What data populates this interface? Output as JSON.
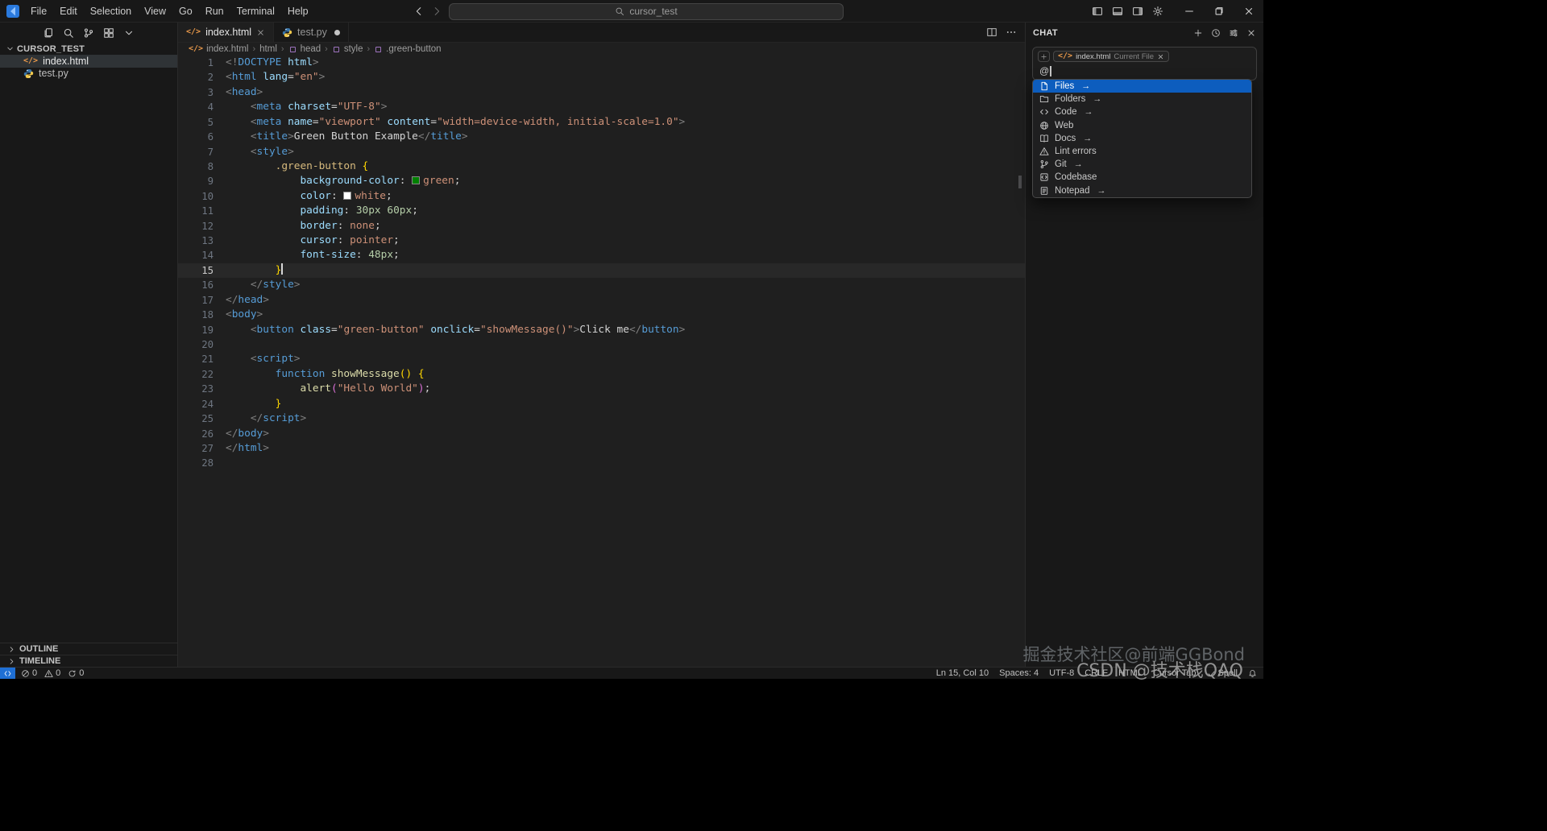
{
  "titlebar": {
    "menu": [
      "File",
      "Edit",
      "Selection",
      "View",
      "Go",
      "Run",
      "Terminal",
      "Help"
    ],
    "search_text": "cursor_test"
  },
  "activity_icons": [
    "explorer",
    "search",
    "source-control",
    "extensions",
    "chevron-down"
  ],
  "explorer": {
    "root": "CURSOR_TEST",
    "files": [
      {
        "name": "index.html",
        "icon": "html",
        "selected": true
      },
      {
        "name": "test.py",
        "icon": "python",
        "selected": false
      }
    ],
    "bottom_sections": [
      "OUTLINE",
      "TIMELINE"
    ]
  },
  "tabs": [
    {
      "label": "index.html",
      "icon": "html",
      "active": true,
      "state": "close"
    },
    {
      "label": "test.py",
      "icon": "python",
      "active": false,
      "state": "modified"
    }
  ],
  "breadcrumb": [
    {
      "label": "index.html",
      "icon": "html"
    },
    {
      "label": "html",
      "icon": null
    },
    {
      "label": "head",
      "icon": "symbol"
    },
    {
      "label": "style",
      "icon": "symbol"
    },
    {
      "label": ".green-button",
      "icon": "symbol"
    }
  ],
  "editor": {
    "active_line": 15,
    "lines": [
      [
        [
          "<!",
          "p"
        ],
        [
          "DOCTYPE",
          "tag"
        ],
        [
          " ",
          "txt"
        ],
        [
          "html",
          "attr"
        ],
        [
          ">",
          "p"
        ]
      ],
      [
        [
          "<",
          "p"
        ],
        [
          "html",
          "tag"
        ],
        [
          " ",
          "txt"
        ],
        [
          "lang",
          "attr"
        ],
        [
          "=",
          "txt"
        ],
        [
          "\"en\"",
          "str"
        ],
        [
          ">",
          "p"
        ]
      ],
      [
        [
          "<",
          "p"
        ],
        [
          "head",
          "tag"
        ],
        [
          ">",
          "p"
        ]
      ],
      [
        [
          "    ",
          "txt"
        ],
        [
          "<",
          "p"
        ],
        [
          "meta",
          "tag"
        ],
        [
          " ",
          "txt"
        ],
        [
          "charset",
          "attr"
        ],
        [
          "=",
          "txt"
        ],
        [
          "\"UTF-8\"",
          "str"
        ],
        [
          ">",
          "p"
        ]
      ],
      [
        [
          "    ",
          "txt"
        ],
        [
          "<",
          "p"
        ],
        [
          "meta",
          "tag"
        ],
        [
          " ",
          "txt"
        ],
        [
          "name",
          "attr"
        ],
        [
          "=",
          "txt"
        ],
        [
          "\"viewport\"",
          "str"
        ],
        [
          " ",
          "txt"
        ],
        [
          "content",
          "attr"
        ],
        [
          "=",
          "txt"
        ],
        [
          "\"width=device-width, initial-scale=1.0\"",
          "str"
        ],
        [
          ">",
          "p"
        ]
      ],
      [
        [
          "    ",
          "txt"
        ],
        [
          "<",
          "p"
        ],
        [
          "title",
          "tag"
        ],
        [
          ">",
          "p"
        ],
        [
          "Green Button Example",
          "txt"
        ],
        [
          "</",
          "p"
        ],
        [
          "title",
          "tag"
        ],
        [
          ">",
          "p"
        ]
      ],
      [
        [
          "    ",
          "txt"
        ],
        [
          "<",
          "p"
        ],
        [
          "style",
          "tag"
        ],
        [
          ">",
          "p"
        ]
      ],
      [
        [
          "        ",
          "txt"
        ],
        [
          ".green-button",
          "sel"
        ],
        [
          " ",
          "txt"
        ],
        [
          "{",
          "b1"
        ]
      ],
      [
        [
          "            ",
          "txt"
        ],
        [
          "background-color",
          "prop"
        ],
        [
          ": ",
          "txt"
        ],
        [
          "green",
          "val",
          "#008000"
        ],
        [
          ";",
          "txt"
        ]
      ],
      [
        [
          "            ",
          "txt"
        ],
        [
          "color",
          "prop"
        ],
        [
          ": ",
          "txt"
        ],
        [
          "white",
          "val",
          "#ffffff"
        ],
        [
          ";",
          "txt"
        ]
      ],
      [
        [
          "            ",
          "txt"
        ],
        [
          "padding",
          "prop"
        ],
        [
          ": ",
          "txt"
        ],
        [
          "30px",
          "num"
        ],
        [
          " ",
          "txt"
        ],
        [
          "60px",
          "num"
        ],
        [
          ";",
          "txt"
        ]
      ],
      [
        [
          "            ",
          "txt"
        ],
        [
          "border",
          "prop"
        ],
        [
          ": ",
          "txt"
        ],
        [
          "none",
          "val"
        ],
        [
          ";",
          "txt"
        ]
      ],
      [
        [
          "            ",
          "txt"
        ],
        [
          "cursor",
          "prop"
        ],
        [
          ": ",
          "txt"
        ],
        [
          "pointer",
          "val"
        ],
        [
          ";",
          "txt"
        ]
      ],
      [
        [
          "            ",
          "txt"
        ],
        [
          "font-size",
          "prop"
        ],
        [
          ": ",
          "txt"
        ],
        [
          "48px",
          "num"
        ],
        [
          ";",
          "txt"
        ]
      ],
      [
        [
          "        ",
          "txt"
        ],
        [
          "}",
          "b1"
        ]
      ],
      [
        [
          "    ",
          "txt"
        ],
        [
          "</",
          "p"
        ],
        [
          "style",
          "tag"
        ],
        [
          ">",
          "p"
        ]
      ],
      [
        [
          "</",
          "p"
        ],
        [
          "head",
          "tag"
        ],
        [
          ">",
          "p"
        ]
      ],
      [
        [
          "<",
          "p"
        ],
        [
          "body",
          "tag"
        ],
        [
          ">",
          "p"
        ]
      ],
      [
        [
          "    ",
          "txt"
        ],
        [
          "<",
          "p"
        ],
        [
          "button",
          "tag"
        ],
        [
          " ",
          "txt"
        ],
        [
          "class",
          "attr"
        ],
        [
          "=",
          "txt"
        ],
        [
          "\"green-button\"",
          "str"
        ],
        [
          " ",
          "txt"
        ],
        [
          "onclick",
          "attr"
        ],
        [
          "=",
          "txt"
        ],
        [
          "\"showMessage()\"",
          "str"
        ],
        [
          ">",
          "p"
        ],
        [
          "Click me",
          "txt"
        ],
        [
          "</",
          "p"
        ],
        [
          "button",
          "tag"
        ],
        [
          ">",
          "p"
        ]
      ],
      [],
      [
        [
          "    ",
          "txt"
        ],
        [
          "<",
          "p"
        ],
        [
          "script",
          "tag"
        ],
        [
          ">",
          "p"
        ]
      ],
      [
        [
          "        ",
          "txt"
        ],
        [
          "function",
          "kw"
        ],
        [
          " ",
          "txt"
        ],
        [
          "showMessage",
          "fn"
        ],
        [
          "(",
          "b1"
        ],
        [
          ")",
          "b1"
        ],
        [
          " ",
          "txt"
        ],
        [
          "{",
          "b1"
        ]
      ],
      [
        [
          "            ",
          "txt"
        ],
        [
          "alert",
          "fn"
        ],
        [
          "(",
          "b2"
        ],
        [
          "\"Hello World\"",
          "str"
        ],
        [
          ")",
          "b2"
        ],
        [
          ";",
          "txt"
        ]
      ],
      [
        [
          "        ",
          "txt"
        ],
        [
          "}",
          "b1"
        ]
      ],
      [
        [
          "    ",
          "txt"
        ],
        [
          "</",
          "p"
        ],
        [
          "script",
          "tag"
        ],
        [
          ">",
          "p"
        ]
      ],
      [
        [
          "</",
          "p"
        ],
        [
          "body",
          "tag"
        ],
        [
          ">",
          "p"
        ]
      ],
      [
        [
          "</",
          "p"
        ],
        [
          "html",
          "tag"
        ],
        [
          ">",
          "p"
        ]
      ],
      []
    ]
  },
  "chat": {
    "title": "CHAT",
    "context_chip": {
      "file": "index.html",
      "hint": "Current File"
    },
    "input_value": "@",
    "menu": [
      {
        "label": "Files",
        "icon": "file",
        "arrow": true,
        "selected": true
      },
      {
        "label": "Folders",
        "icon": "folder",
        "arrow": true,
        "selected": false
      },
      {
        "label": "Code",
        "icon": "code",
        "arrow": true,
        "selected": false
      },
      {
        "label": "Web",
        "icon": "globe",
        "arrow": false,
        "selected": false
      },
      {
        "label": "Docs",
        "icon": "book",
        "arrow": true,
        "selected": false
      },
      {
        "label": "Lint errors",
        "icon": "warning",
        "arrow": false,
        "selected": false
      },
      {
        "label": "Git",
        "icon": "git-branch",
        "arrow": true,
        "selected": false
      },
      {
        "label": "Codebase",
        "icon": "codebase",
        "arrow": false,
        "selected": false
      },
      {
        "label": "Notepad",
        "icon": "notepad",
        "arrow": true,
        "selected": false
      }
    ]
  },
  "statusbar": {
    "left": [
      {
        "icon": "error",
        "label": "0"
      },
      {
        "icon": "warning",
        "label": "0"
      },
      {
        "icon": "sync",
        "label": "0"
      }
    ],
    "right": [
      {
        "icon": null,
        "label": "Ln 15, Col 10"
      },
      {
        "icon": null,
        "label": "Spaces: 4"
      },
      {
        "icon": null,
        "label": "UTF-8"
      },
      {
        "icon": null,
        "label": "CRLF"
      },
      {
        "icon": null,
        "label": "HTML"
      },
      {
        "icon": null,
        "label": "Cursor Tab"
      },
      {
        "icon": "check",
        "label": "Spell"
      },
      {
        "icon": "bell",
        "label": ""
      }
    ]
  },
  "watermarks": [
    "掘金技术社区@前端GGBond",
    "CSDN @技术栈QAQ"
  ]
}
